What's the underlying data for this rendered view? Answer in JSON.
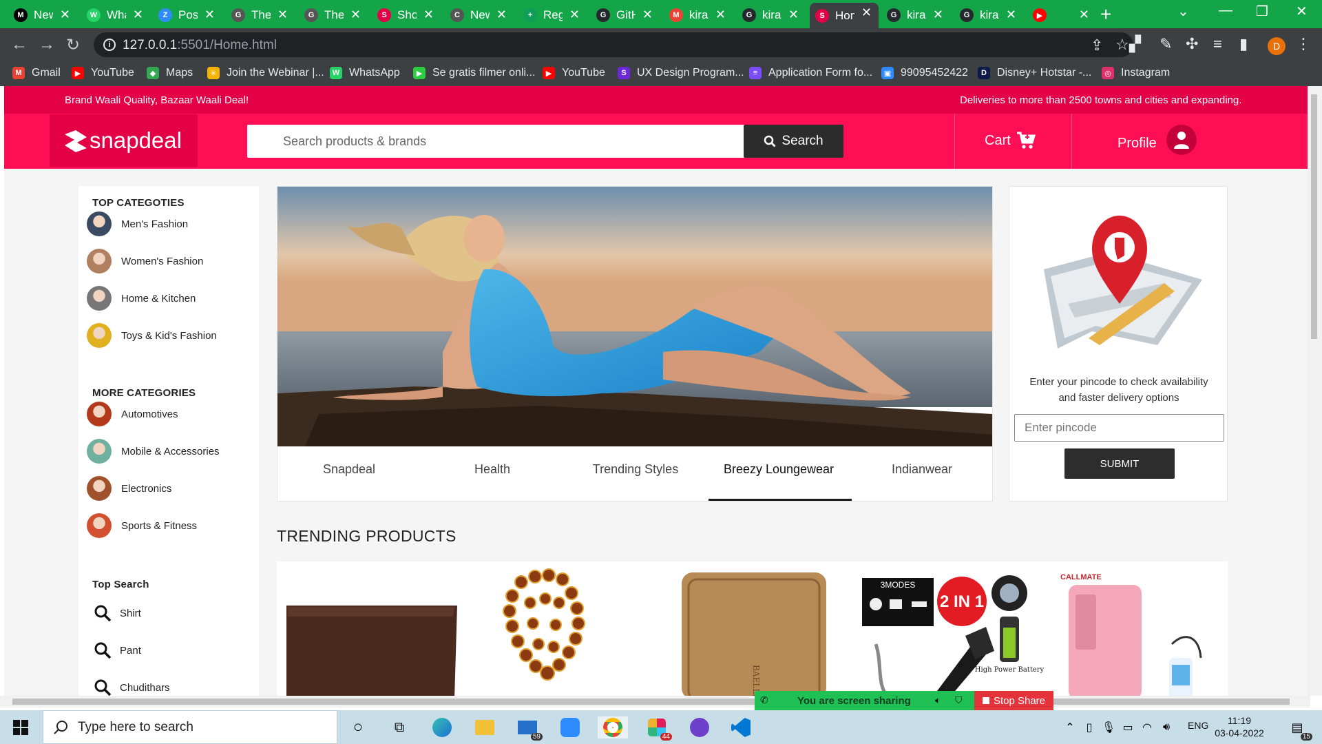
{
  "browser": {
    "tabs": [
      {
        "title": "New",
        "color": "#000000",
        "glyph": "M"
      },
      {
        "title": "WhatsApp",
        "color": "#25d366",
        "glyph": "W"
      },
      {
        "title": "Post",
        "color": "#2d8cff",
        "glyph": "Z"
      },
      {
        "title": "The",
        "color": "#555555",
        "glyph": "G"
      },
      {
        "title": "The",
        "color": "#555555",
        "glyph": "G"
      },
      {
        "title": "Shop",
        "color": "#e40046",
        "glyph": "S"
      },
      {
        "title": "New",
        "color": "#555555",
        "glyph": "C"
      },
      {
        "title": "Reg",
        "color": "#0f9d58",
        "glyph": "+"
      },
      {
        "title": "GitHub",
        "color": "#24292e",
        "glyph": "G"
      },
      {
        "title": "kira",
        "color": "#ea4335",
        "glyph": "M"
      },
      {
        "title": "kira",
        "color": "#24292e",
        "glyph": "G"
      },
      {
        "title": "Home",
        "color": "#e40046",
        "glyph": "S"
      },
      {
        "title": "kira",
        "color": "#24292e",
        "glyph": "G"
      },
      {
        "title": "kira",
        "color": "#24292e",
        "glyph": "G"
      },
      {
        "title": "",
        "color": "#ff0000",
        "glyph": "▶"
      }
    ],
    "active_tab_index": 11,
    "url_host": "127.0.0.1",
    "url_path": ":5501/Home.html",
    "profile_letter": "D",
    "bookmarks": [
      {
        "label": "Gmail",
        "color": "#ea4335",
        "glyph": "M"
      },
      {
        "label": "YouTube",
        "color": "#ff0000",
        "glyph": "▶"
      },
      {
        "label": "Maps",
        "color": "#34a853",
        "glyph": "◆"
      },
      {
        "label": "Join the Webinar |...",
        "color": "#f4b400",
        "glyph": "✳"
      },
      {
        "label": "WhatsApp",
        "color": "#25d366",
        "glyph": "W"
      },
      {
        "label": "Se gratis filmer onli...",
        "color": "#2ecc40",
        "glyph": "▶"
      },
      {
        "label": "YouTube",
        "color": "#ff0000",
        "glyph": "▶"
      },
      {
        "label": "UX Design Program...",
        "color": "#6d28d9",
        "glyph": "S"
      },
      {
        "label": "Application Form fo...",
        "color": "#7c4dff",
        "glyph": "≡"
      },
      {
        "label": "99095452422",
        "color": "#2d8cff",
        "glyph": "▣"
      },
      {
        "label": "Disney+ Hotstar -...",
        "color": "#0c1a48",
        "glyph": "D"
      },
      {
        "label": "Instagram",
        "color": "#e1306c",
        "glyph": "◎"
      }
    ]
  },
  "site": {
    "strip_left": "Brand Waali Quality, Bazaar Waali Deal!",
    "strip_right": "Deliveries to more than 2500 towns and cities and expanding.",
    "logo_text": "snapdeal",
    "search_placeholder": "Search products & brands",
    "search_button": "Search",
    "cart_label": "Cart",
    "profile_label": "Profile",
    "brand_color": "#fe0f55",
    "brand_dark": "#e40046"
  },
  "sidebar": {
    "top_heading": "TOP CATEGOTIES",
    "top_items": [
      {
        "label": "Men's Fashion",
        "color": "#3b4a63"
      },
      {
        "label": "Women's Fashion",
        "color": "#b08060"
      },
      {
        "label": "Home & Kitchen",
        "color": "#777777"
      },
      {
        "label": "Toys & Kid's Fashion",
        "color": "#e0b020"
      }
    ],
    "more_heading": "MORE CATEGORIES",
    "more_items": [
      {
        "label": "Automotives",
        "color": "#b23a1a"
      },
      {
        "label": "Mobile & Accessories",
        "color": "#6fb0a0"
      },
      {
        "label": "Electronics",
        "color": "#a0522d"
      },
      {
        "label": "Sports & Fitness",
        "color": "#d05030"
      }
    ],
    "search_heading": "Top Search",
    "search_items": [
      "Shirt",
      "Pant",
      "Chudithars"
    ]
  },
  "banner": {
    "tabs": [
      "Snapdeal",
      "Health",
      "Trending Styles",
      "Breezy Loungewear",
      "Indianwear"
    ],
    "active_tab": 3
  },
  "pincode": {
    "text": "Enter your pincode to check availability and faster delivery options",
    "placeholder": "Enter pincode",
    "submit": "SUBMIT"
  },
  "trending": {
    "title": "TRENDING PRODUCTS",
    "labels": {
      "modes": "3MODES",
      "two_in_one": "2 IN 1",
      "battery": "High Power Battery",
      "brand": "CALLMATE",
      "wallet_brand": "BAELLERRY"
    }
  },
  "sharing": {
    "status": "You are screen sharing",
    "stop": "Stop Share"
  },
  "taskbar": {
    "search_placeholder": "Type here to search",
    "mail_badge": "59",
    "slack_badge": "44",
    "lang": "ENG",
    "time": "11:19",
    "date": "03-04-2022",
    "notif_count": "15"
  }
}
